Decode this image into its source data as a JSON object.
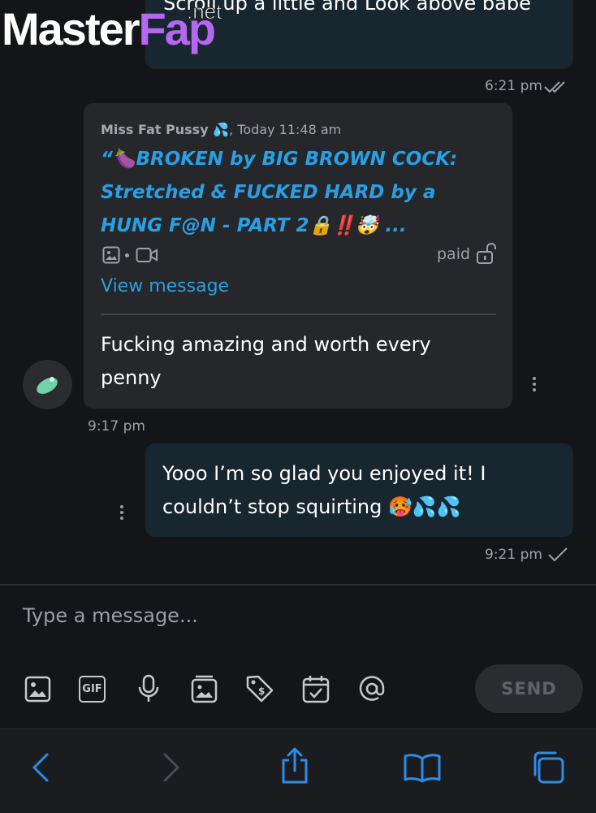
{
  "watermark": {
    "part1": "Master",
    "part2": "Fap",
    "suffix": ".net"
  },
  "messages": {
    "top_fragment": "Scroll up a little and Look above babe",
    "top_time": "6:21 pm",
    "incoming": {
      "quote_author": "Miss Fat Pussy 💦",
      "quote_time": ", Today 11:48 am",
      "quote_text": "“🍆BROKEN by BIG BROWN COCK: Stretched & FUCKED HARD by a HUNG F@N - PART 2🔒‼️🤯 ...",
      "paid_label": "paid",
      "view_message": "View message",
      "text": "Fucking amazing and worth every penny",
      "time": "9:17 pm"
    },
    "outgoing": {
      "text": "Yooo I’m so glad you enjoyed it! I couldn’t stop squirting 🥵💦💦",
      "time": "9:21 pm"
    }
  },
  "composer": {
    "placeholder": "Type a message...",
    "send_label": "SEND",
    "tools": [
      "image-icon",
      "gif-icon",
      "microphone-icon",
      "vault-icon",
      "price-tag-icon",
      "calendar-icon",
      "mention-icon"
    ],
    "gif_text": "GIF"
  },
  "browser_bar": {
    "icons": [
      "back-icon",
      "forward-icon",
      "share-icon",
      "bookmarks-icon",
      "tabs-icon"
    ]
  },
  "colors": {
    "background": "#141518",
    "outgoing_bubble": "#18262f",
    "incoming_bubble": "#26272b",
    "accent": "#2b9fe0",
    "send_disabled": "#2b2c30"
  }
}
